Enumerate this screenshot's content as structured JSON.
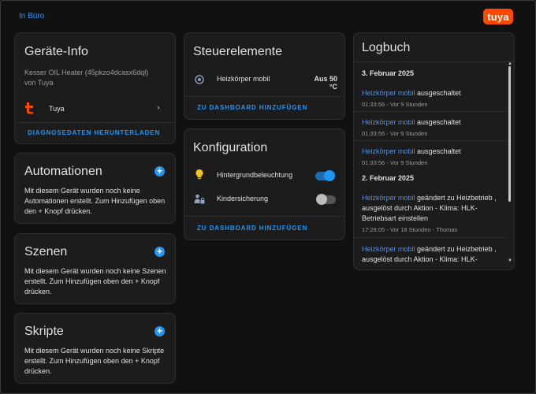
{
  "breadcrumb": "In Büro",
  "brand_logo": "tuya",
  "device_info": {
    "title": "Geräte-Info",
    "model": "Kesser OIL Heater (45pkzo4dcasx6dql)",
    "manufacturer": "von Tuya",
    "integration": "Tuya",
    "integration_icon": "tuya-icon",
    "download_label": "DIAGNOSEDATEN HERUNTERLADEN"
  },
  "automations": {
    "title": "Automationen",
    "text": "Mit diesem Gerät wurden noch keine Automationen erstellt. Zum Hinzufügen oben den + Knopf drücken."
  },
  "scenes": {
    "title": "Szenen",
    "text": "Mit diesem Gerät wurden noch keine Szenen erstellt. Zum Hinzufügen oben den + Knopf drücken."
  },
  "scripts": {
    "title": "Skripte",
    "text": "Mit diesem Gerät wurden noch keine Skripte erstellt. Zum Hinzufügen oben den + Knopf drücken."
  },
  "controls": {
    "title": "Steuerelemente",
    "entity_name": "Heizkörper mobil",
    "entity_state": "Aus 50 °C",
    "add_label": "ZU DASHBOARD HINZUFÜGEN"
  },
  "configuration": {
    "title": "Konfiguration",
    "items": [
      {
        "label": "Hintergrundbeleuchtung",
        "icon": "lightbulb-icon",
        "state": "on"
      },
      {
        "label": "Kindersicherung",
        "icon": "child-lock-icon",
        "state": "off"
      }
    ],
    "add_label": "ZU DASHBOARD HINZUFÜGEN"
  },
  "logbook": {
    "title": "Logbuch",
    "groups": [
      {
        "date": "3. Februar 2025",
        "entries": [
          {
            "entity": "Heizkörper mobil",
            "action": "ausgeschaltet",
            "meta": "01:33:56 - Vor 9 Stunden"
          },
          {
            "entity": "Heizkörper mobil",
            "action": "ausgeschaltet",
            "meta": "01:33:56 - Vor 9 Stunden"
          },
          {
            "entity": "Heizkörper mobil",
            "action": "ausgeschaltet",
            "meta": "01:33:56 - Vor 9 Stunden"
          }
        ]
      },
      {
        "date": "2. Februar 2025",
        "entries": [
          {
            "entity": "Heizkörper mobil",
            "action": "geändert zu Heizbetrieb , ausgelöst durch Aktion - Klima: HLK-Betriebsart einstellen",
            "meta": "17:28:05 - Vor 18 Stunden - Thomas"
          },
          {
            "entity": "Heizkörper mobil",
            "action": "geändert zu Heizbetrieb , ausgelöst durch Aktion - Klima: HLK-",
            "meta": ""
          }
        ]
      }
    ]
  },
  "colors": {
    "accent": "#2196f3",
    "background": "#111111",
    "card": "#1c1c1c",
    "brand": "#ff4800",
    "bulb": "#f5c518"
  }
}
